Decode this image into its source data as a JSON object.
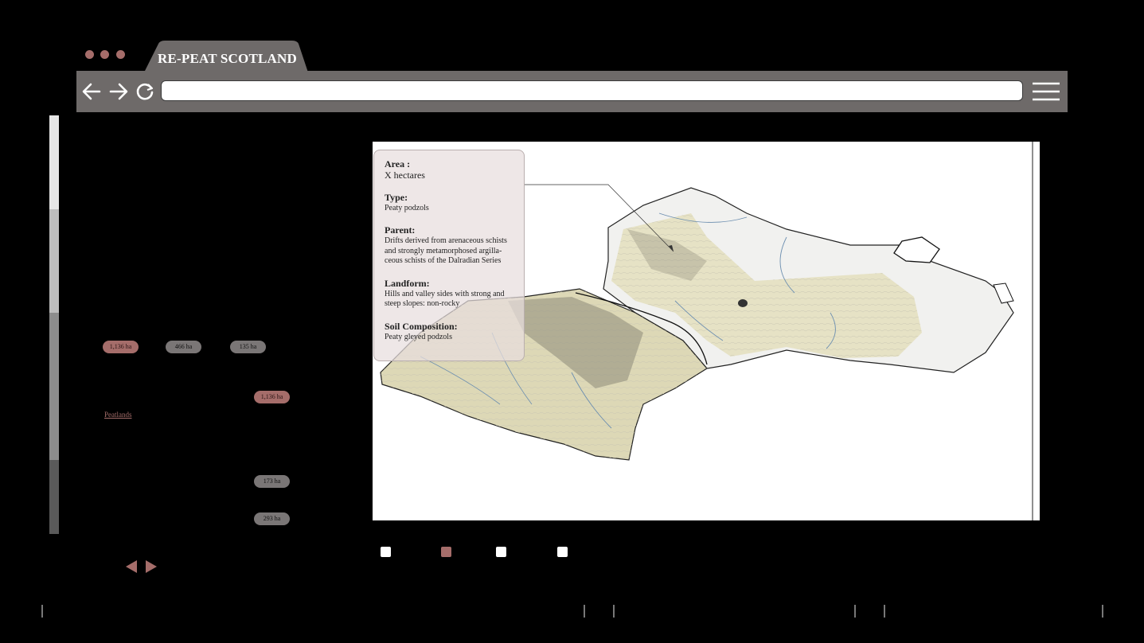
{
  "window": {
    "tab_title": "RE-PEAT SCOTLAND",
    "url": "",
    "icons": [
      "back-arrow-icon",
      "forward-arrow-icon",
      "reload-icon",
      "hamburger-menu-icon"
    ]
  },
  "colors": {
    "accent": "#a56d6a",
    "toolbar": "#6e6a69",
    "pill_grey": "#7a7676",
    "peat_fill": "#e4e0c0"
  },
  "left_panel": {
    "row1_pills": [
      "1,136 ha",
      "466 ha",
      "135 ha"
    ],
    "peat_pill": "1,136 ha",
    "peat_label": "Peatlands",
    "pill_173": "173 ha",
    "pill_293": "293 ha",
    "nav": [
      "previous-arrow-icon",
      "next-arrow-icon"
    ]
  },
  "info_card": {
    "area_label": "Area :",
    "area_value": "X hectares",
    "type_label": "Type:",
    "type_value": "Peaty podzols",
    "parent_label": "Parent:",
    "parent_value": "Drifts derived from arenaceous schists and strongly metamorphosed argilla-ceous schists of the Dalradian Series",
    "landform_label": "Landform:",
    "landform_value": "Hills and valley sides with strong and steep slopes: non-rocky",
    "soil_label": "Soil Composition:",
    "soil_value": "Peaty gleyed podzols"
  },
  "legend_squares": [
    "white",
    "accent",
    "white",
    "white"
  ]
}
